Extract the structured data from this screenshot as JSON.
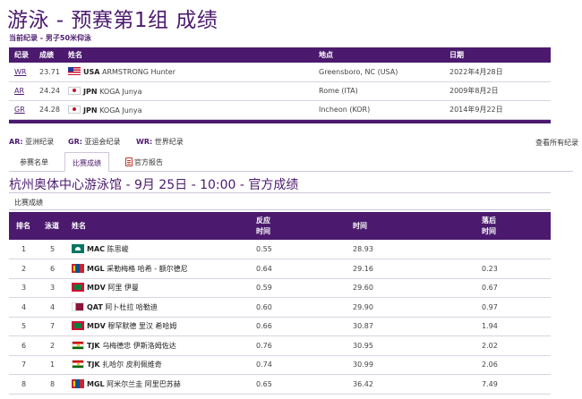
{
  "page": {
    "title": "游泳 - 预赛第1组 成绩",
    "record_caption": "当前纪录 - 男子50米仰泳"
  },
  "records_table": {
    "headers": [
      "纪录",
      "成绩",
      "姓名",
      "地点",
      "日期"
    ],
    "rows": [
      {
        "type": "WR",
        "result": "23.71",
        "flag": "usa-flag-icon",
        "noc": "USA",
        "name": "ARMSTRONG Hunter",
        "location": "Greensboro, NC (USA)",
        "date": "2022年4月28日"
      },
      {
        "type": "AR",
        "result": "24.24",
        "flag": "jpn-flag-icon",
        "noc": "JPN",
        "name": "KOGA Junya",
        "location": "Rome (ITA)",
        "date": "2009年8月2日"
      },
      {
        "type": "GR",
        "result": "24.28",
        "flag": "jpn-flag-icon",
        "noc": "JPN",
        "name": "KOGA Junya",
        "location": "Incheon (KOR)",
        "date": "2014年9月22日"
      }
    ]
  },
  "legend": {
    "ar_key": "AR:",
    "ar_label": "亚洲纪录",
    "gr_key": "GR:",
    "gr_label": "亚运会纪录",
    "wr_key": "WR:",
    "wr_label": "世界纪录",
    "view_all": "查看所有纪录"
  },
  "tabs": [
    {
      "label": "参赛名单",
      "active": false
    },
    {
      "label": "比赛成绩",
      "active": true
    },
    {
      "label": "官方报告",
      "active": false,
      "icon": "document-icon"
    }
  ],
  "venue_title": "杭州奥体中心游泳馆 - 9月 25日 - 10:00 - 官方成绩",
  "results_caption": "比赛成绩",
  "results_table": {
    "headers": {
      "rank": "排名",
      "lane": "泳道",
      "name": "姓名",
      "reaction_1": "反应",
      "reaction_2": "时间",
      "time": "时间",
      "behind_1": "落后",
      "behind_2": "时间"
    },
    "rows": [
      {
        "rank": "1",
        "lane": "5",
        "flag": "mac-flag-icon",
        "noc": "MAC",
        "name": "陈思峻",
        "reaction": "0.55",
        "time": "28.93",
        "behind": ""
      },
      {
        "rank": "2",
        "lane": "6",
        "flag": "mgl-flag-icon",
        "noc": "MGL",
        "name": "采勒梅格 哈希 - 额尔德尼",
        "reaction": "0.64",
        "time": "29.16",
        "behind": "0.23"
      },
      {
        "rank": "3",
        "lane": "3",
        "flag": "mdv-flag-icon",
        "noc": "MDV",
        "name": "阿里 伊曼",
        "reaction": "0.59",
        "time": "29.60",
        "behind": "0.67"
      },
      {
        "rank": "4",
        "lane": "4",
        "flag": "qat-flag-icon",
        "noc": "QAT",
        "name": "阿卜杜拉 哈勒迪",
        "reaction": "0.60",
        "time": "29.90",
        "behind": "0.97"
      },
      {
        "rank": "5",
        "lane": "7",
        "flag": "mdv-flag-icon",
        "noc": "MDV",
        "name": "穆罕默德 里汉 希哈姆",
        "reaction": "0.66",
        "time": "30.87",
        "behind": "1.94"
      },
      {
        "rank": "6",
        "lane": "2",
        "flag": "tjk-flag-icon",
        "noc": "TJK",
        "name": "乌梅德忠 伊斯洛姆佐达",
        "reaction": "0.76",
        "time": "30.95",
        "behind": "2.02"
      },
      {
        "rank": "7",
        "lane": "1",
        "flag": "tjk-flag-icon",
        "noc": "TJK",
        "name": "扎哈尔 皮利佩维奇",
        "reaction": "0.74",
        "time": "30.99",
        "behind": "2.06"
      },
      {
        "rank": "8",
        "lane": "8",
        "flag": "mgl-flag-icon",
        "noc": "MGL",
        "name": "阿米尔兰圭 阿里巴苏赫",
        "reaction": "0.65",
        "time": "36.42",
        "behind": "7.49"
      }
    ]
  },
  "colors": {
    "brand_purple": "#4b1a6e"
  }
}
